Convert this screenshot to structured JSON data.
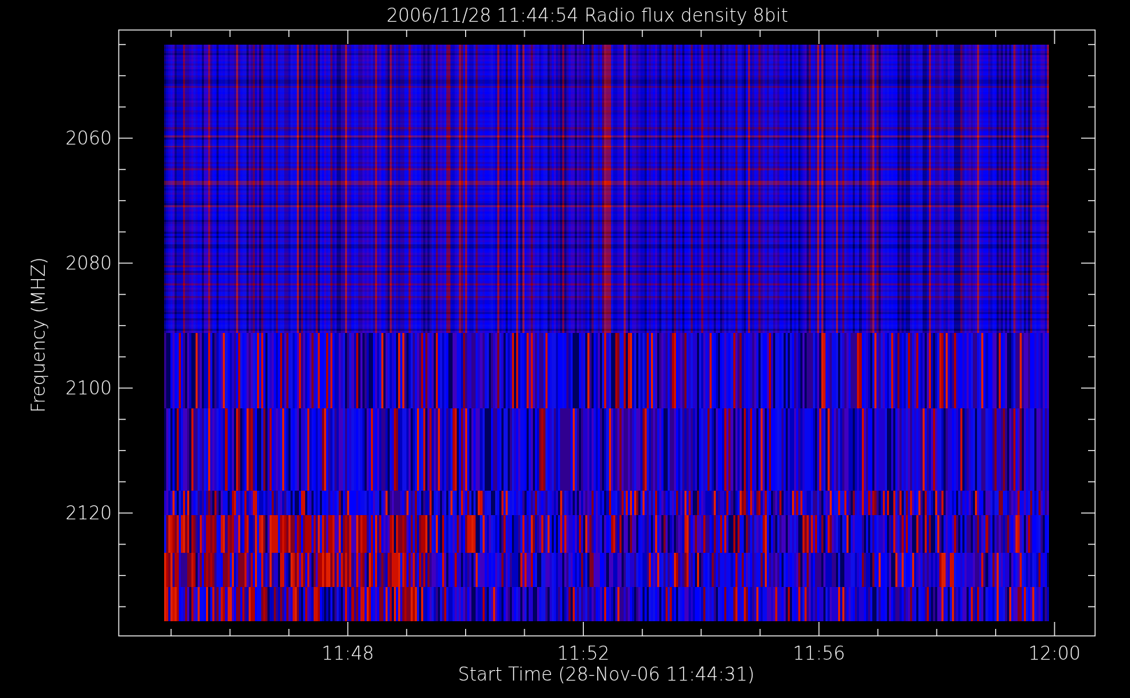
{
  "title": "2006/11/28 11:44:54 Radio flux density 8bit",
  "y_axis": {
    "label": "Frequency (MHZ)",
    "ticks": [
      "2060",
      "2080",
      "2100",
      "2120"
    ]
  },
  "x_axis": {
    "label": "Start Time (28-Nov-06 11:44:31)",
    "ticks": [
      "11:48",
      "11:52",
      "11:56",
      "12:00"
    ]
  }
}
